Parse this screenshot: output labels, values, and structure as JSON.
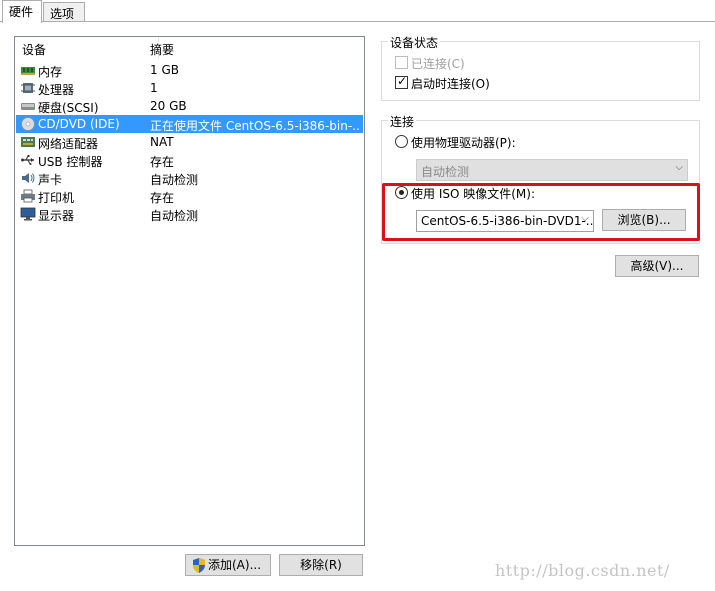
{
  "tabs": [
    {
      "label": "硬件",
      "active": true
    },
    {
      "label": "选项",
      "active": false
    }
  ],
  "device_list": {
    "columns": [
      "设备",
      "摘要"
    ],
    "rows": [
      {
        "icon": "memory-icon",
        "name": "内存",
        "summary": "1 GB",
        "selected": false
      },
      {
        "icon": "processor-icon",
        "name": "处理器",
        "summary": "1",
        "selected": false
      },
      {
        "icon": "harddisk-icon",
        "name": "硬盘(SCSI)",
        "summary": "20 GB",
        "selected": false
      },
      {
        "icon": "cd-dvd-icon",
        "name": "CD/DVD (IDE)",
        "summary": "正在使用文件 CentOS-6.5-i386-bin-...",
        "selected": true
      },
      {
        "icon": "network-adapter-icon",
        "name": "网络适配器",
        "summary": "NAT",
        "selected": false
      },
      {
        "icon": "usb-icon",
        "name": "USB 控制器",
        "summary": "存在",
        "selected": false
      },
      {
        "icon": "sound-card-icon",
        "name": "声卡",
        "summary": "自动检测",
        "selected": false
      },
      {
        "icon": "printer-icon",
        "name": "打印机",
        "summary": "存在",
        "selected": false
      },
      {
        "icon": "display-icon",
        "name": "显示器",
        "summary": "自动检测",
        "selected": false
      }
    ]
  },
  "buttons": {
    "add": "添加(A)...",
    "remove": "移除(R)",
    "browse": "浏览(B)...",
    "advanced": "高级(V)..."
  },
  "device_status": {
    "title": "设备状态",
    "connected": {
      "label": "已连接(C)",
      "checked": false,
      "disabled": true
    },
    "connect_at_power_on": {
      "label": "启动时连接(O)",
      "checked": true
    }
  },
  "connection": {
    "title": "连接",
    "physical": {
      "label": "使用物理驱动器(P):",
      "selected": false,
      "drive_value": "自动检测"
    },
    "iso": {
      "label": "使用 ISO 映像文件(M):",
      "selected": true,
      "file_value": "CentOS-6.5-i386-bin-DVD1-.."
    }
  },
  "watermark": "http://blog.csdn.net/",
  "colors": {
    "selection": "#3399ff",
    "highlight_box": "#d9121a"
  }
}
